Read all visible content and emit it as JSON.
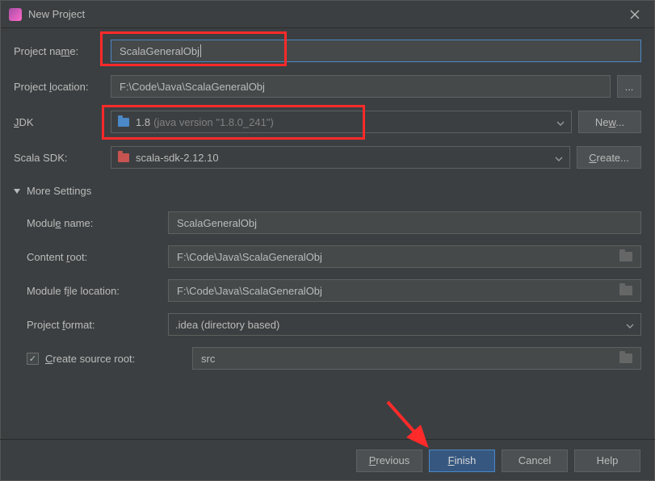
{
  "window": {
    "title": "New Project"
  },
  "labels": {
    "project_name": "Project name:",
    "project_location": "Project location:",
    "jdk": "JDK",
    "scala_sdk": "Scala SDK:",
    "more_settings": "More Settings",
    "module_name": "Module name:",
    "content_root": "Content root:",
    "module_file_location": "Module file location:",
    "project_format": "Project format:",
    "create_source_root": "Create source root:"
  },
  "values": {
    "project_name": "ScalaGeneralObj",
    "project_location": "F:\\Code\\Java\\ScalaGeneralObj",
    "jdk_main": "1.8",
    "jdk_detail": "(java version \"1.8.0_241\")",
    "scala_sdk": "scala-sdk-2.12.10",
    "module_name": "ScalaGeneralObj",
    "content_root": "F:\\Code\\Java\\ScalaGeneralObj",
    "module_file_location": "F:\\Code\\Java\\ScalaGeneralObj",
    "project_format": ".idea (directory based)",
    "source_root": "src"
  },
  "buttons": {
    "new": "New...",
    "create": "Create...",
    "previous": "Previous",
    "finish": "Finish",
    "cancel": "Cancel",
    "help": "Help",
    "browse": "..."
  }
}
